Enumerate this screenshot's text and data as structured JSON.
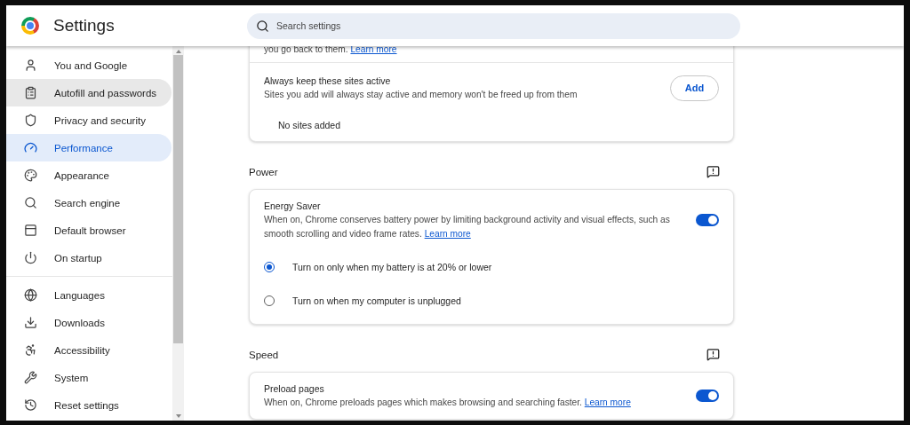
{
  "header": {
    "title": "Settings",
    "search": {
      "placeholder": "Search settings"
    }
  },
  "sidebar": {
    "groups": [
      {
        "items": [
          {
            "label": "You and Google",
            "selected": false,
            "hovered": false
          },
          {
            "label": "Autofill and passwords",
            "selected": false,
            "hovered": true
          },
          {
            "label": "Privacy and security",
            "selected": false,
            "hovered": false
          },
          {
            "label": "Performance",
            "selected": true,
            "hovered": false
          },
          {
            "label": "Appearance",
            "selected": false,
            "hovered": false
          },
          {
            "label": "Search engine",
            "selected": false,
            "hovered": false
          },
          {
            "label": "Default browser",
            "selected": false,
            "hovered": false
          },
          {
            "label": "On startup",
            "selected": false,
            "hovered": false
          }
        ]
      },
      {
        "items": [
          {
            "label": "Languages",
            "selected": false,
            "hovered": false
          },
          {
            "label": "Downloads",
            "selected": false,
            "hovered": false
          },
          {
            "label": "Accessibility",
            "selected": false,
            "hovered": false
          },
          {
            "label": "System",
            "selected": false,
            "hovered": false
          },
          {
            "label": "Reset settings",
            "selected": false,
            "hovered": false
          }
        ]
      }
    ]
  },
  "content": {
    "top_card": {
      "partial_text": "you go back to them.",
      "link": "Learn more",
      "row": {
        "title": "Always keep these sites active",
        "description": "Sites you add will always stay active and memory won't be freed up from them",
        "button": "Add"
      },
      "empty_text": "No sites added"
    },
    "sections": [
      {
        "title": "Power",
        "card": {
          "title": "Energy Saver",
          "description": "When on, Chrome conserves battery power by limiting background activity and visual effects, such as smooth scrolling and video frame rates.",
          "link": "Learn more",
          "on": true,
          "options": [
            {
              "label": "Turn on only when my battery is at 20% or lower",
              "selected": true
            },
            {
              "label": "Turn on when my computer is unplugged",
              "selected": false
            }
          ]
        }
      },
      {
        "title": "Speed",
        "card": {
          "title": "Preload pages",
          "description": "When on, Chrome preloads pages which makes browsing and searching faster.",
          "link": "Learn more",
          "on": true
        }
      }
    ]
  }
}
